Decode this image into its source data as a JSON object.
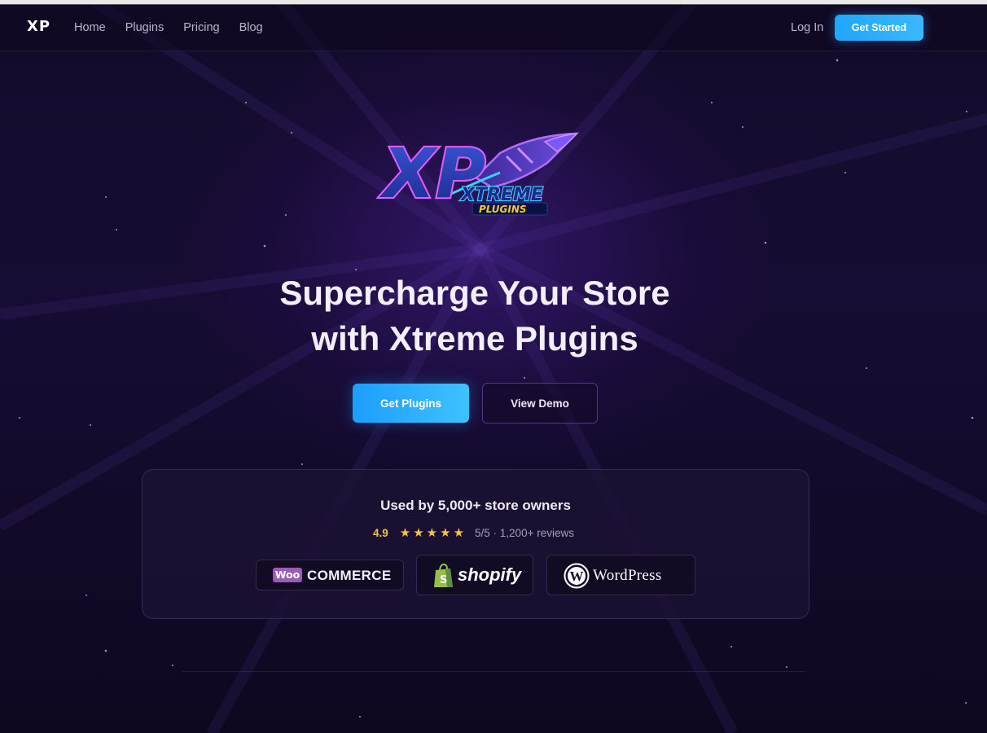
{
  "nav": {
    "brand": "XP",
    "links": [
      "Home",
      "Plugins",
      "Pricing",
      "Blog"
    ],
    "login": "Log In",
    "cta": "Get Started"
  },
  "logo": {
    "mark": "XP",
    "line1": "XTREME",
    "line2": "PLUGINS",
    "icon": "rocket-icon"
  },
  "hero": {
    "title_line1": "Supercharge Your Store",
    "title_line2": "with Xtreme Plugins",
    "primary_button": "Get Plugins",
    "secondary_button": "View Demo"
  },
  "proof": {
    "title": "Used by 5,000+ store owners",
    "rating_score": "4.9",
    "stars": "★★★★★",
    "rating_value": 5,
    "rating_max": 5,
    "rating_meta": "5/5 · 1,200+ reviews",
    "platforms": [
      {
        "badge": "Woo",
        "name": "COMMERCE",
        "icon": "woocommerce-icon"
      },
      {
        "name": "shopify",
        "icon": "shopify-bag-icon"
      },
      {
        "name": "WordPress",
        "icon": "wordpress-icon"
      }
    ]
  },
  "colors": {
    "accent": "#1fa6ff",
    "star": "#f5c343",
    "background": "#140b2b",
    "woo_purple": "#9b5cb7",
    "shopify_green": "#95bf47"
  }
}
